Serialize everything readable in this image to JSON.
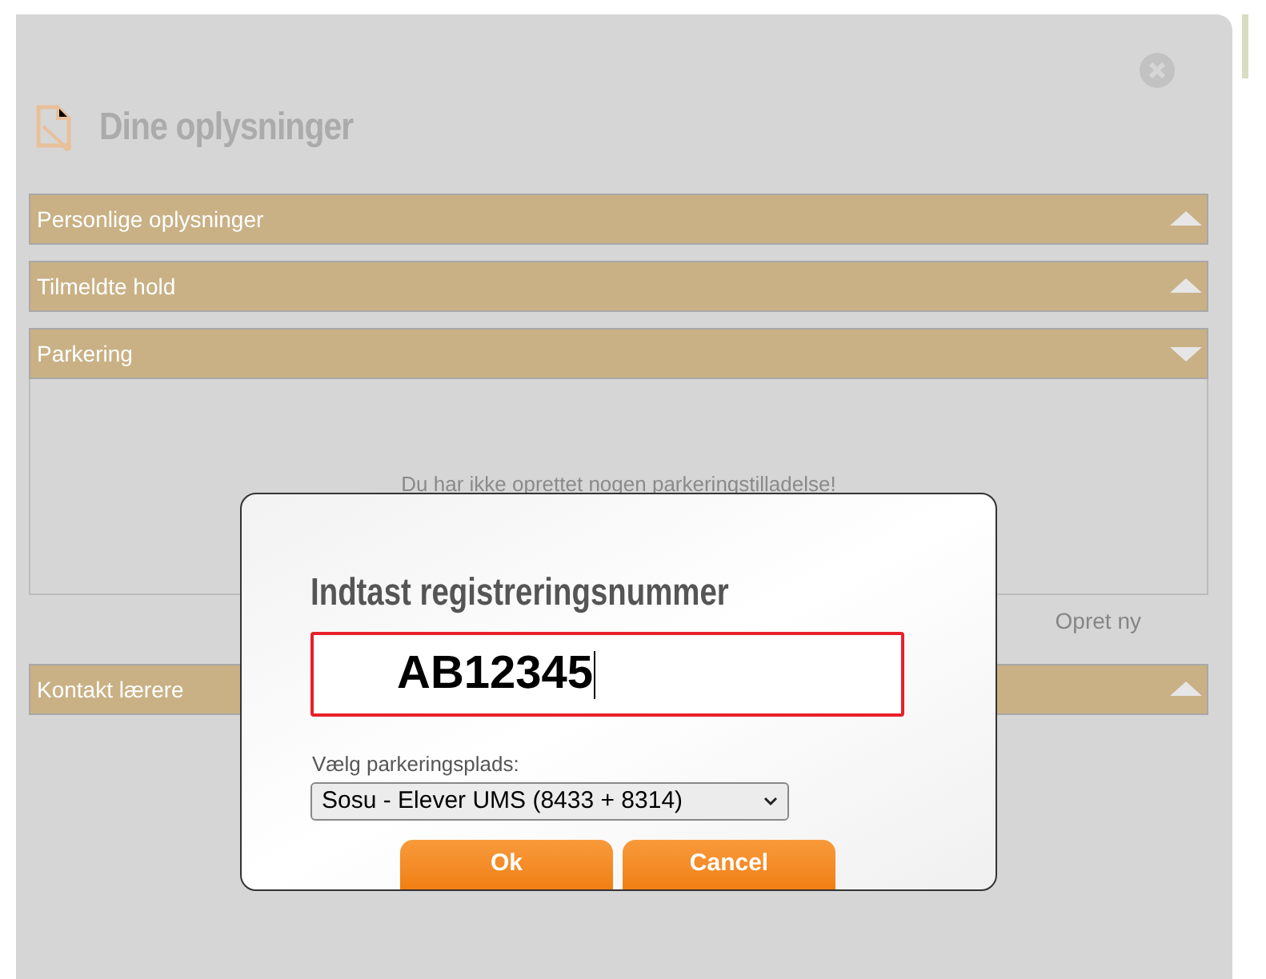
{
  "page": {
    "title": "Dine oplysninger"
  },
  "sections": [
    {
      "title": "Personlige oplysninger",
      "expanded": false
    },
    {
      "title": "Tilmeldte hold",
      "expanded": false
    },
    {
      "title": "Parkering",
      "expanded": true,
      "empty_message": "Du har ikke oprettet nogen parkeringstilladelse!",
      "action": "Opret ny"
    },
    {
      "title": "Kontakt lærere",
      "expanded": false
    }
  ],
  "dialog": {
    "title": "Indtast registreringsnummer",
    "input_value": "AB12345",
    "select_label": "Vælg parkeringsplads:",
    "select_value": "Sosu - Elever UMS (8433 + 8314)",
    "buttons": [
      "Ok",
      "Cancel"
    ]
  }
}
